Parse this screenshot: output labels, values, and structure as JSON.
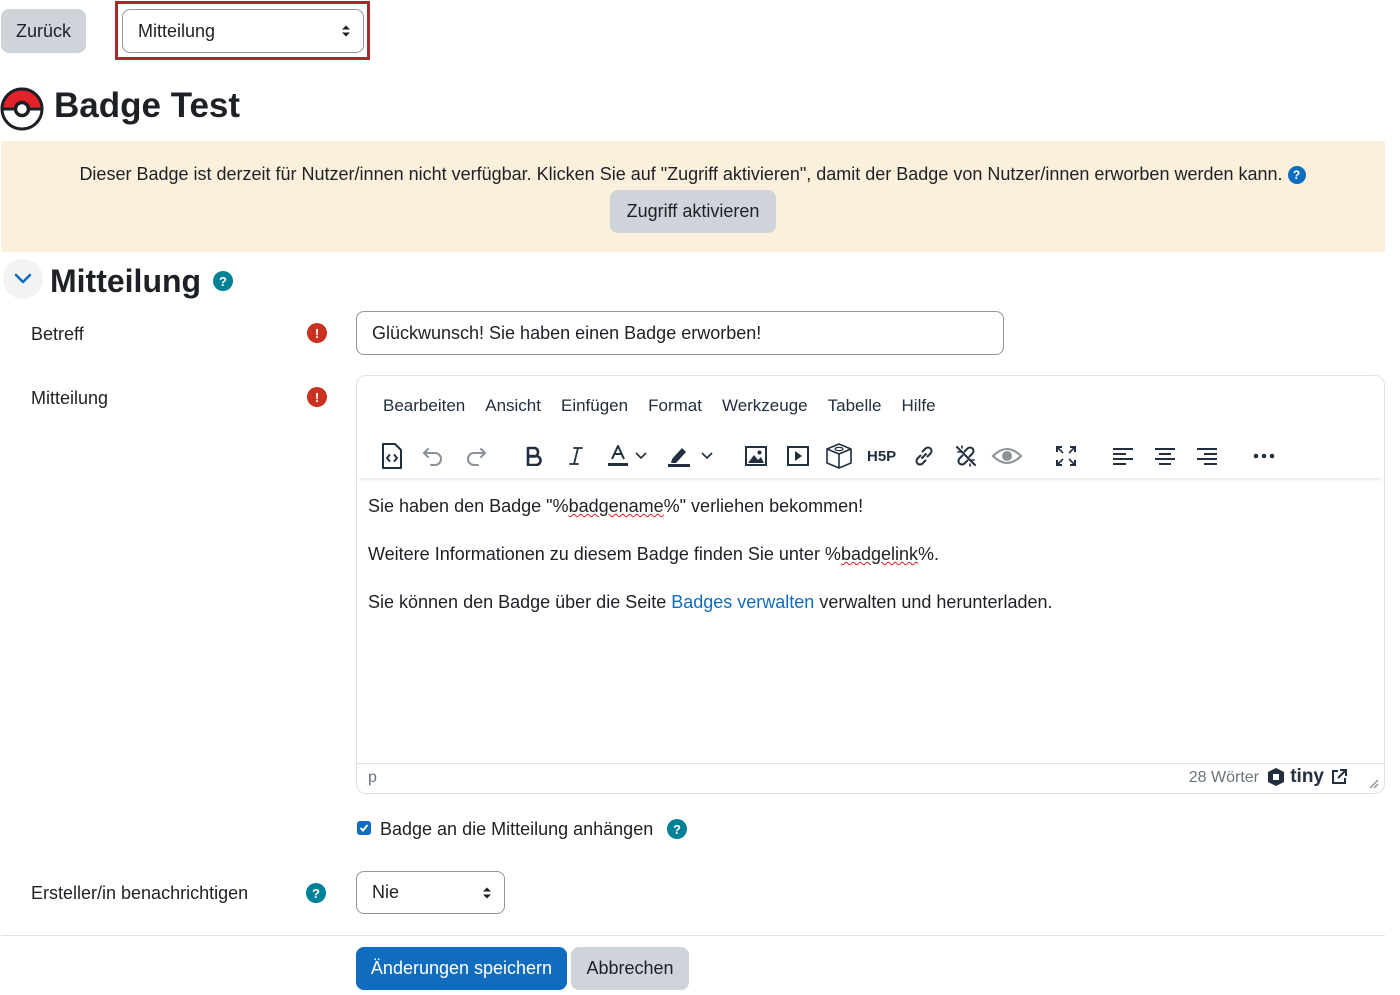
{
  "topbar": {
    "back_label": "Zurück",
    "page_select_value": "Mitteilung"
  },
  "page": {
    "title": "Badge Test"
  },
  "banner": {
    "text": "Dieser Badge ist derzeit für Nutzer/innen nicht verfügbar. Klicken Sie auf \"Zugriff aktivieren\", damit der Badge von Nutzer/innen erworben werden kann.",
    "button_label": "Zugriff aktivieren"
  },
  "section": {
    "title": "Mitteilung"
  },
  "form": {
    "subject_label": "Betreff",
    "subject_value": "Glückwunsch! Sie haben einen Badge erworben!",
    "message_label": "Mitteilung",
    "attach_label": "Badge an die Mitteilung anhängen",
    "notify_label": "Ersteller/in benachrichtigen",
    "notify_value": "Nie",
    "save_label": "Änderungen speichern",
    "cancel_label": "Abbrechen"
  },
  "editor": {
    "menus": [
      "Bearbeiten",
      "Ansicht",
      "Einfügen",
      "Format",
      "Werkzeuge",
      "Tabelle",
      "Hilfe"
    ],
    "toolbar_icons": [
      "source-code-icon",
      "undo-icon",
      "redo-icon",
      "bold-icon",
      "italic-icon",
      "text-color-icon",
      "highlight-color-icon",
      "image-icon",
      "media-icon",
      "h5p-cube-icon",
      "h5p-logo-icon",
      "link-icon",
      "unlink-icon",
      "preview-eye-icon",
      "fullscreen-icon",
      "align-left-icon",
      "align-center-icon",
      "align-right-icon",
      "more-icon"
    ],
    "paragraph1_pre": "Sie haben den Badge \"%",
    "paragraph1_word": "badgename",
    "paragraph1_post": "%\" verliehen bekommen!",
    "paragraph2_pre": "Weitere Informationen zu diesem Badge finden Sie unter %",
    "paragraph2_word": "badgelink",
    "paragraph2_post": "%.",
    "paragraph3_pre": "Sie können den Badge über die Seite ",
    "paragraph3_link": "Badges verwalten",
    "paragraph3_post": " verwalten und herunterladen.",
    "status_path": "p",
    "word_count": "28 Wörter",
    "brand": "tiny"
  },
  "colors": {
    "primary": "#0f6cbf",
    "banner_bg": "#fcefdc",
    "required": "#ca3120",
    "help": "#008196",
    "highlight_border": "#a82a2a"
  }
}
